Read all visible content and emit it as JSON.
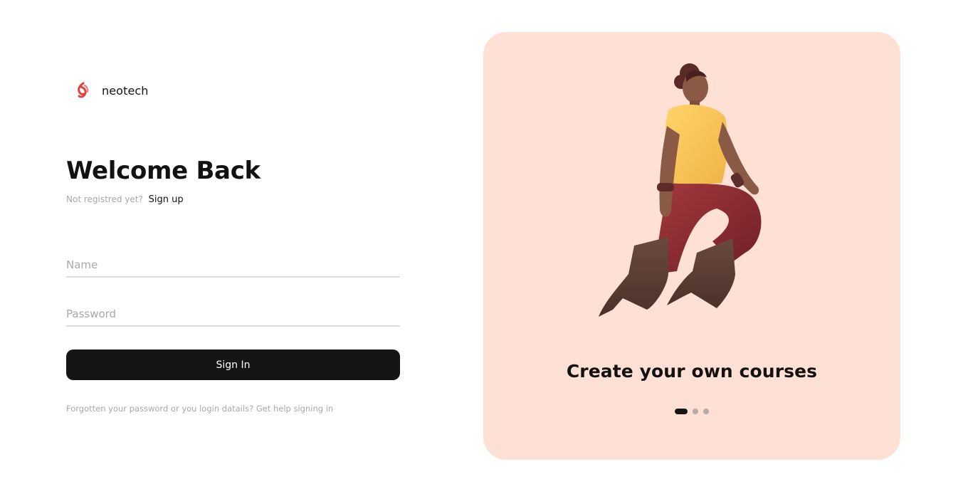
{
  "brand": {
    "name": "neotech",
    "logo_icon": "flame-spiral-logo-icon",
    "logo_color": "#e2403f"
  },
  "login": {
    "title": "Welcome Back",
    "not_registered_text": "Not registred yet?",
    "signup_link": "Sign up",
    "name_field": {
      "placeholder": "Name",
      "value": ""
    },
    "password_field": {
      "placeholder": "Password",
      "value": ""
    },
    "signin_button": "Sign In",
    "help_text": "Forgotten your password or you login datails?",
    "help_link": "Get help signing in"
  },
  "carousel": {
    "slide_title": "Create your own courses",
    "illustration_icon": "flying-person-illustration",
    "slide_count": 3,
    "active_slide": 1,
    "background_color": "#ffe0d4"
  },
  "colors": {
    "primary": "#171414",
    "muted_text": "#a9a6a6",
    "field_border": "#dcdcdc"
  }
}
